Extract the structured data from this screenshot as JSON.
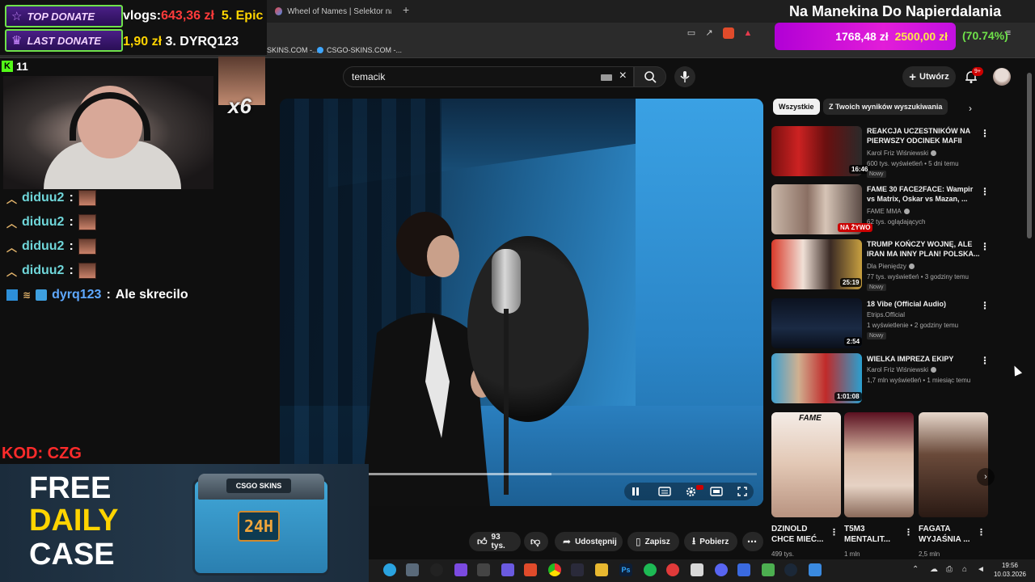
{
  "browser": {
    "tabs": [
      {
        "label": "Wheel of Names | Selektor nazw loso"
      }
    ],
    "bookmarks": [
      "SKINS.COM -...",
      "CSGO-SKINS.COM -..."
    ]
  },
  "youtube": {
    "search": {
      "value": "temacik"
    },
    "create_label": "Utwórz",
    "notifications_count": "9+",
    "filters": [
      "Wszystkie",
      "Z Twoich wyników wyszukiwania"
    ],
    "actions": {
      "likes": "93 tys.",
      "share": "Udostępnij",
      "save": "Zapisz",
      "download": "Pobierz"
    },
    "video_progress_fraction": 0.47,
    "recommendations": [
      {
        "title": "REAKCJA UCZESTNIKÓW NA PIERWSZY ODCINEK MAFII",
        "channel": "Karol Friz Wiśniewski",
        "stats": "600 tys. wyświetleń • 5 dni temu",
        "badge": "Nowy",
        "duration": "16:46",
        "live": false
      },
      {
        "title": "FAME 30 FACE2FACE: Wampir vs Matrix, Oskar vs Mazan, ...",
        "channel": "FAME MMA",
        "stats": "62 tys. oglądających",
        "badge": "",
        "duration": "NA ŻYWO",
        "live": true
      },
      {
        "title": "TRUMP KOŃCZY WOJNĘ, ALE IRAN MA INNY PLAN! POLSKA...",
        "channel": "Dla Pieniędzy",
        "stats": "77 tys. wyświetleń • 3 godziny temu",
        "badge": "Nowy",
        "duration": "25:19",
        "live": false
      },
      {
        "title": "18 Vibe (Official Audio)",
        "channel": "Etrips.Official",
        "stats": "1 wyświetlenie • 2 godziny temu",
        "badge": "Nowy",
        "duration": "2:54",
        "live": false
      },
      {
        "title": "WIELKA IMPREZA EKIPY",
        "channel": "Karol Friz Wiśniewski",
        "stats": "1,7 mln wyświetleń • 1 miesiąc temu",
        "badge": "",
        "duration": "1:01:08",
        "live": false
      }
    ],
    "shorts": [
      {
        "title": "DZINOLD CHCE MIEĆ...",
        "views": "499 tys.",
        "brand": "FAME"
      },
      {
        "title": "T5M3 MENTALIT...",
        "views": "1 mln",
        "brand": ""
      },
      {
        "title": "FAGATA WYJAŚNIA ...",
        "views": "2,5 mln",
        "brand": ""
      }
    ]
  },
  "taskbar": {
    "time": "19:56",
    "date": "10.03.2026"
  },
  "overlay": {
    "top_donate_label": "TOP DONATE",
    "last_donate_label": "LAST DONATE",
    "top_donate_text": {
      "prefix": "vlogs: ",
      "amount": "643,36 zł",
      "rank": "  5. Epic"
    },
    "last_donate_text": {
      "amount": "1,90 zł",
      "rank": " 3. DYRQ123"
    },
    "title": "Na Manekina Do Napierdalania",
    "goal": {
      "current": "1768,48 zł",
      "target": "2500,00 zł",
      "percent": "(70.74%)",
      "fraction": 0.7074
    },
    "viewers": "11",
    "emote_multiplier": "x6",
    "chat": [
      {
        "user": "diduu2",
        "message": ""
      },
      {
        "user": "diduu2",
        "message": ""
      },
      {
        "user": "diduu2",
        "message": ""
      },
      {
        "user": "diduu2",
        "message": ""
      },
      {
        "user": "dyrq123",
        "message": "Ale skrecilo"
      }
    ],
    "promo_code": "KOD: CZG",
    "promo_lines": [
      "FREE",
      "DAILY",
      "CASE"
    ],
    "crate_logo": "CSGO SKINS",
    "crate_tag": "24H",
    "colors": {
      "accent_green": "#6fe24a",
      "goal_magenta": "#e21dd8",
      "red": "#ff2b2b",
      "yellow": "#ffd400"
    }
  }
}
